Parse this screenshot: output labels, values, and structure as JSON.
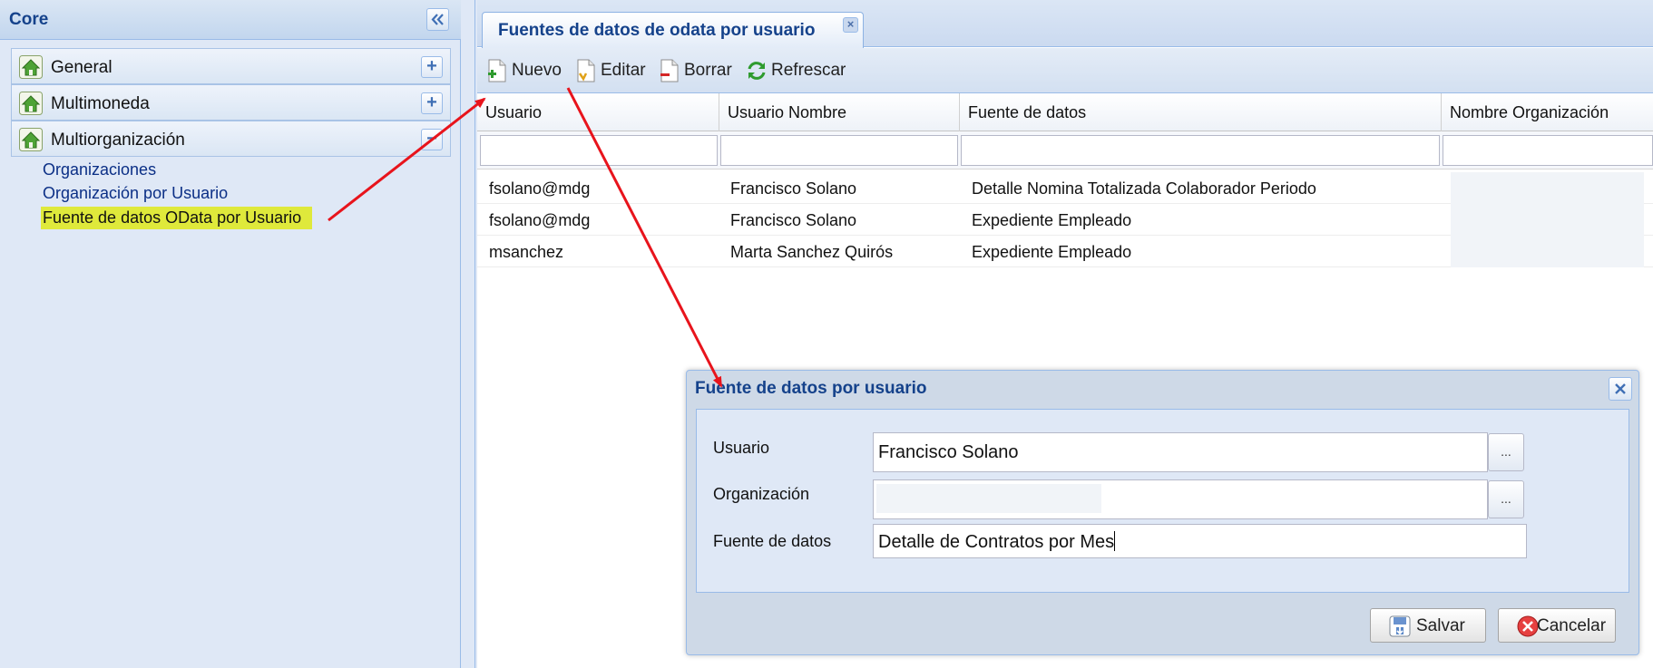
{
  "nav": {
    "title": "Core",
    "sections": [
      {
        "label": "General",
        "toggle": "+"
      },
      {
        "label": "Multimoneda",
        "toggle": "+"
      },
      {
        "label": "Multiorganización",
        "toggle": "−"
      }
    ],
    "links": [
      {
        "label": "Organizaciones"
      },
      {
        "label": "Organización por Usuario"
      },
      {
        "label": "Fuente de datos OData por Usuario"
      }
    ]
  },
  "tab": {
    "label": "Fuentes de datos de odata por usuario",
    "close": "×"
  },
  "toolbar": {
    "new_label": "Nuevo",
    "edit_label": "Editar",
    "delete_label": "Borrar",
    "refresh_label": "Refrescar"
  },
  "grid": {
    "columns": [
      "Usuario",
      "Usuario Nombre",
      "Fuente de datos",
      "Nombre Organización"
    ],
    "rows": [
      {
        "usuario": "fsolano@mdg",
        "nombre": "Francisco Solano",
        "fuente": "Detalle Nomina Totalizada Colaborador Periodo"
      },
      {
        "usuario": "fsolano@mdg",
        "nombre": "Francisco Solano",
        "fuente": "Expediente Empleado"
      },
      {
        "usuario": "msanchez",
        "nombre": "Marta Sanchez Quirós",
        "fuente": "Expediente Empleado"
      }
    ]
  },
  "dialog": {
    "title": "Fuente de datos por usuario",
    "fields": {
      "usuario_label": "Usuario",
      "usuario_value": "Francisco Solano",
      "organizacion_label": "Organización",
      "organizacion_value": "",
      "fuente_label": "Fuente de datos",
      "fuente_value": "Detalle de Contratos por Mes"
    },
    "trigger_label": "...",
    "save_label": "Salvar",
    "cancel_label": "Cancelar"
  },
  "colors": {
    "panel_bg": "#dfe8f6",
    "title_blue": "#15428b",
    "link_blue": "#0b2f86",
    "highlight": "#dfe93b",
    "annotation_arrow": "#e8141c"
  },
  "icons": [
    "collapse-left-icon",
    "home-icon",
    "new-doc-icon",
    "edit-doc-icon",
    "delete-doc-icon",
    "refresh-icon",
    "save-icon",
    "cancel-icon",
    "close-icon",
    "chevron-down-icon"
  ]
}
